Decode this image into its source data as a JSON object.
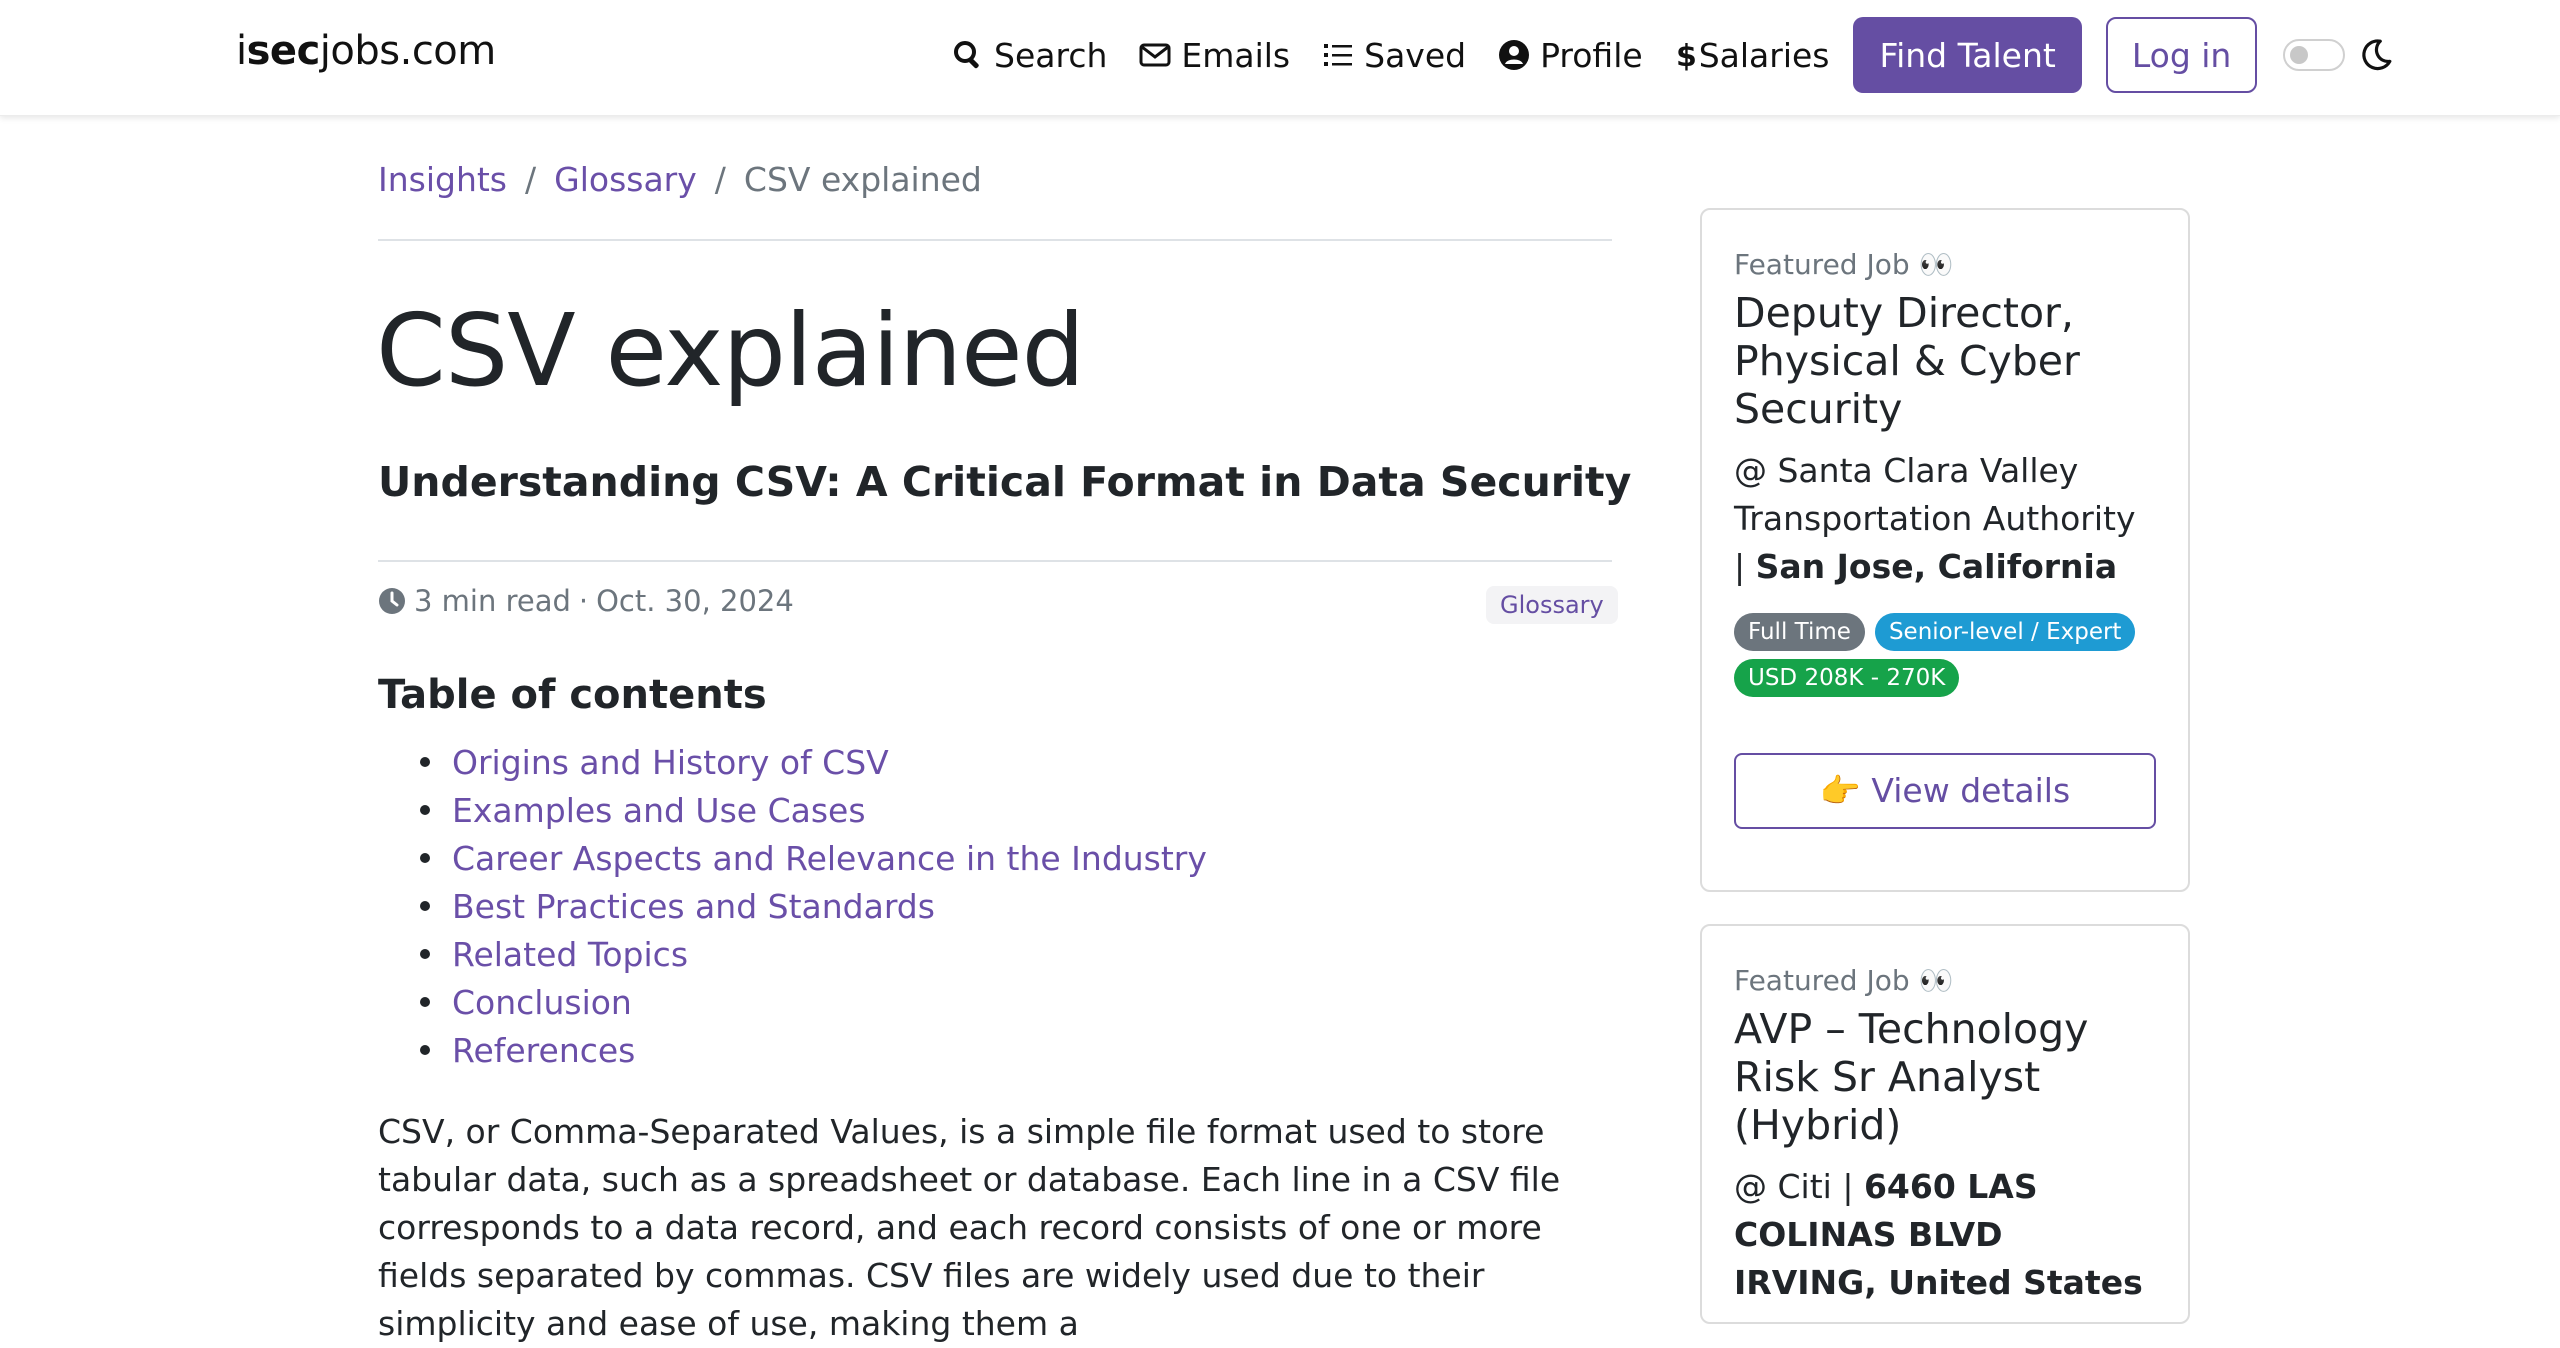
{
  "brand": {
    "part1": "i",
    "part2": "sec",
    "part3": "jobs.com"
  },
  "nav": {
    "search": "Search",
    "emails": "Emails",
    "saved": "Saved",
    "profile": "Profile",
    "salaries": "Salaries",
    "find_talent": "Find Talent",
    "login": "Log in"
  },
  "breadcrumb": {
    "items": [
      "Insights",
      "Glossary"
    ],
    "separator": "/",
    "current": "CSV explained"
  },
  "article": {
    "title": "CSV explained",
    "subtitle": "Understanding CSV: A Critical Format in Data Security",
    "read_time": "3 min read",
    "dot": "·",
    "date": "Oct. 30, 2024",
    "tag": "Glossary",
    "toc_title": "Table of contents",
    "toc": [
      "Origins and History of CSV",
      "Examples and Use Cases",
      "Career Aspects and Relevance in the Industry",
      "Best Practices and Standards",
      "Related Topics",
      "Conclusion",
      "References"
    ],
    "body": "CSV, or Comma-Separated Values, is a simple file format used to store tabular data, such as a spreadsheet or database. Each line in a CSV file corresponds to a data record, and each record consists of one or more fields separated by commas. CSV files are widely used due to their simplicity and ease of use, making them a"
  },
  "sidebar": {
    "jobs": [
      {
        "label": "Featured Job 👀",
        "title": "Deputy Director, Physical & Cyber Security",
        "company": "@ Santa Clara Valley Transportation Authority",
        "separator": "|",
        "location": "San Jose, California",
        "badges": [
          {
            "text": "Full Time",
            "color": "#6c757d"
          },
          {
            "text": "Senior-level / Expert",
            "color": "#1e9bd3"
          },
          {
            "text": "USD 208K - 270K",
            "color": "#16a34a"
          }
        ],
        "button": "👉 View details"
      },
      {
        "label": "Featured Job 👀",
        "title": "AVP – Technology Risk Sr Analyst (Hybrid)",
        "company": "@ Citi",
        "separator": "|",
        "location": "6460 LAS COLINAS BLVD IRVING, United States"
      }
    ]
  },
  "colors": {
    "accent": "#654ea3",
    "link": "#6a4fa8",
    "muted": "#6c757d"
  }
}
